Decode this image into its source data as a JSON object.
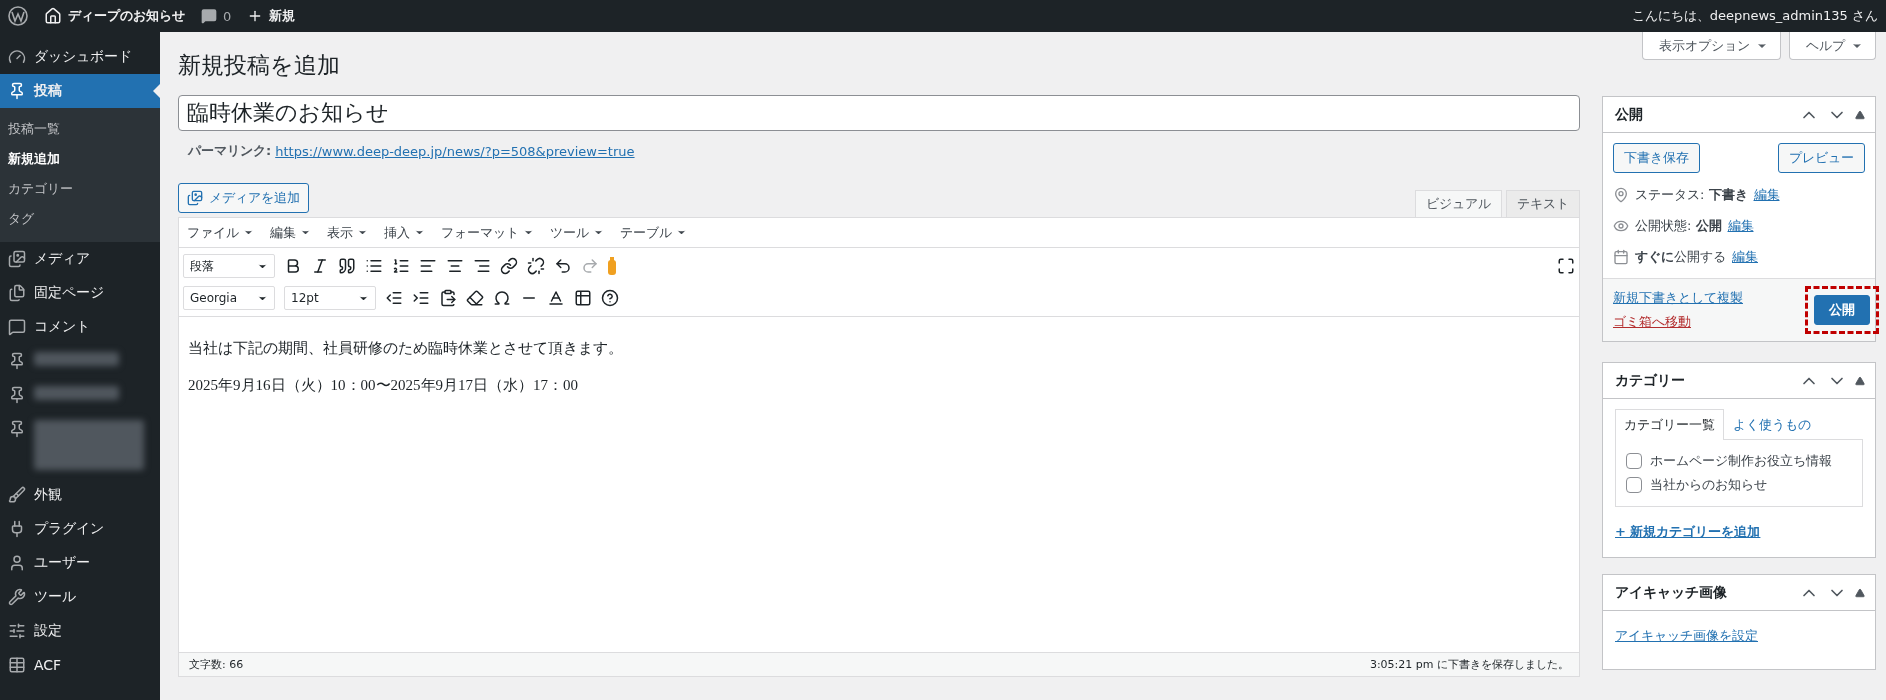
{
  "admin_bar": {
    "site_name": "ディープのお知らせ",
    "comments_count": "0",
    "new_label": "新規",
    "greeting": "こんにちは、deepnews_admin135 さん"
  },
  "sidebar": {
    "items": [
      {
        "kind": "item",
        "label": "ダッシュボード",
        "selected": false
      },
      {
        "kind": "item",
        "label": "投稿",
        "selected": true,
        "children": [
          {
            "label": "投稿一覧",
            "selected": false
          },
          {
            "label": "新規追加",
            "selected": true
          },
          {
            "label": "カテゴリー",
            "selected": false
          },
          {
            "label": "タグ",
            "selected": false
          }
        ]
      },
      {
        "kind": "item",
        "label": "メディア",
        "selected": false
      },
      {
        "kind": "item",
        "label": "固定ページ",
        "selected": false
      },
      {
        "kind": "item",
        "label": "コメント",
        "selected": false
      },
      {
        "kind": "blurred"
      },
      {
        "kind": "blurred"
      },
      {
        "kind": "blurredtall"
      },
      {
        "kind": "item",
        "label": "外観",
        "selected": false
      },
      {
        "kind": "item",
        "label": "プラグイン",
        "selected": false
      },
      {
        "kind": "item",
        "label": "ユーザー",
        "selected": false
      },
      {
        "kind": "item",
        "label": "ツール",
        "selected": false
      },
      {
        "kind": "item",
        "label": "設定",
        "selected": false
      },
      {
        "kind": "item",
        "label": "ACF",
        "selected": false
      }
    ]
  },
  "screen_buttons": [
    "表示オプション",
    "ヘルプ"
  ],
  "page_title": "新規投稿を追加",
  "post_title": "臨時休業のお知らせ",
  "permalink": {
    "label": "パーマリンク:",
    "url": "https://www.deep-deep.jp/news/?p=508&preview=true"
  },
  "add_media": "メディアを追加",
  "editor_tabs": [
    {
      "label": "ビジュアル",
      "selected": true
    },
    {
      "label": "テキスト",
      "selected": false
    }
  ],
  "editor_menu": [
    "ファイル",
    "編集",
    "表示",
    "挿入",
    "フォーマット",
    "ツール",
    "テーブル"
  ],
  "format_select": "段落",
  "font_select": "Georgia",
  "size_select": "12pt",
  "content": [
    "当社は下記の期間、社員研修のため臨時休業とさせて頂きます。",
    "2025年9月16日（火）10：00〜2025年9月17日（水）17：00"
  ],
  "status_bar": {
    "word_count": "文字数: 66",
    "saved": "3:05:21 pm に下書きを保存しました。"
  },
  "publish_box": {
    "title": "公開",
    "save_draft": "下書き保存",
    "preview": "プレビュー",
    "rows": [
      {
        "text": "ステータス: **下書き**",
        "link": "編集"
      },
      {
        "text": "公開状態: **公開**",
        "link": "編集"
      },
      {
        "text": "**すぐに**公開する",
        "link": "編集"
      }
    ],
    "copy_link": "新規下書きとして複製",
    "trash_link": "ゴミ箱へ移動",
    "publish_button": "公開",
    "highlighted": true
  },
  "category_box": {
    "title": "カテゴリー",
    "tabs": [
      {
        "label": "カテゴリー一覧",
        "selected": true
      },
      {
        "label": "よく使うもの",
        "selected": false
      }
    ],
    "items": [
      {
        "label": "ホームページ制作お役立ち情報",
        "checked": false
      },
      {
        "label": "当社からのお知らせ",
        "checked": false
      }
    ],
    "add_link": "+ 新規カテゴリーを追加"
  },
  "featured_box": {
    "title": "アイキャッチ画像",
    "link": "アイキャッチ画像を設定"
  }
}
